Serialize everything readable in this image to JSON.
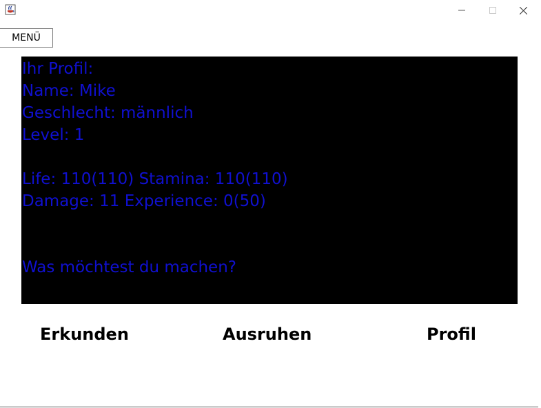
{
  "window": {
    "icon": "java-cup-icon",
    "controls": {
      "minimize_icon": "minimize-icon",
      "maximize_icon": "maximize-icon",
      "close_icon": "close-icon"
    }
  },
  "menu": {
    "label": "MENÜ"
  },
  "console": {
    "lines": [
      "Ihr Profil:",
      "Name: Mike",
      "Geschlecht: männlich",
      "Level: 1",
      "",
      "Life: 110(110) Stamina: 110(110)",
      "Damage: 11 Experience: 0(50)",
      "",
      "",
      "Was möchtest du machen?"
    ],
    "background_color": "#000000",
    "text_color": "#1010d0"
  },
  "actions": {
    "explore_label": "Erkunden",
    "rest_label": "Ausruhen",
    "profile_label": "Profil"
  }
}
